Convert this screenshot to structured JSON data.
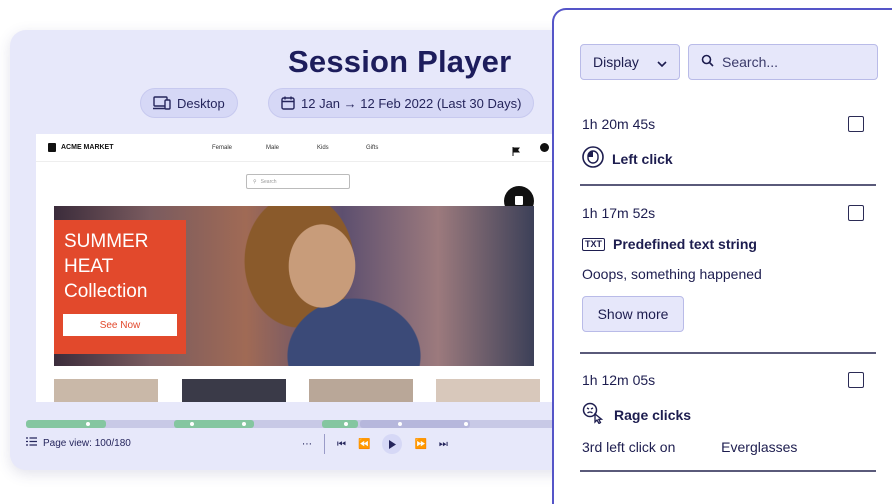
{
  "player": {
    "title": "Session Player",
    "device_label": "Desktop",
    "date_range": "12 Jan → 12 Feb 2022 (Last 30 Days)",
    "page_view": "Page view: 100/180"
  },
  "site": {
    "brand": "ACME MARKET",
    "nav": [
      "Female",
      "Male",
      "Kids",
      "Gifts"
    ],
    "search_placeholder": "Search",
    "promo_lines": [
      "SUMMER",
      "HEAT",
      "Collection"
    ],
    "promo_cta": "See Now"
  },
  "panel": {
    "display_label": "Display",
    "search_placeholder": "Search...",
    "show_more": "Show more",
    "events": [
      {
        "time": "1h 20m 45s",
        "kind": "Left click",
        "icon": "left-click-icon",
        "desc": ""
      },
      {
        "time": "1h 17m 52s",
        "kind": "Predefined text string",
        "icon": "txt-icon",
        "desc": "Ooops, something happened"
      },
      {
        "time": "1h 12m 05s",
        "kind": "Rage clicks",
        "icon": "rage-click-icon",
        "desc": "3rd left click on",
        "target": "Everglasses"
      }
    ]
  },
  "colors": {
    "accent": "#5555c8",
    "card_bg": "#e7e8fa",
    "timeline_green": "#84c6a0",
    "promo_red": "#e2492c"
  }
}
